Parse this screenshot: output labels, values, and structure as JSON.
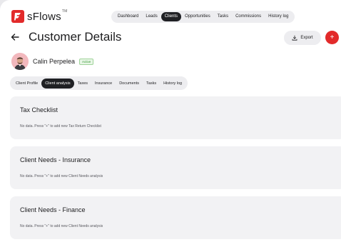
{
  "brand": {
    "name": "sFlows",
    "tm": "TM"
  },
  "topnav": {
    "items": [
      "Dashboard",
      "Leads",
      "Clients",
      "Opportunities",
      "Tasks",
      "Commissions",
      "History log"
    ],
    "active": "Clients"
  },
  "page": {
    "title": "Customer Details"
  },
  "actions": {
    "export_label": "Export",
    "add_label": "+"
  },
  "client": {
    "name": "Calin Perpelea",
    "status": "Active"
  },
  "subtabs": {
    "items": [
      "Client Profile",
      "Client analysis",
      "Taxes",
      "Insurance",
      "Documents",
      "Tasks",
      "History log"
    ],
    "active": "Client analysis"
  },
  "sections": [
    {
      "title": "Tax Checklist",
      "empty": "No data. Press \"+\" to add new Tax Return Checklist"
    },
    {
      "title": "Client Needs - Insurance",
      "empty": "No data. Press \"+\" to add new Client Needs analysis"
    },
    {
      "title": "Client Needs - Finance",
      "empty": "No data. Press \"+\" to add new Client Needs analysis"
    }
  ],
  "colors": {
    "accent": "#e22a2a",
    "active_tab": "#1f2024",
    "status_green": "#3a9a3a"
  }
}
